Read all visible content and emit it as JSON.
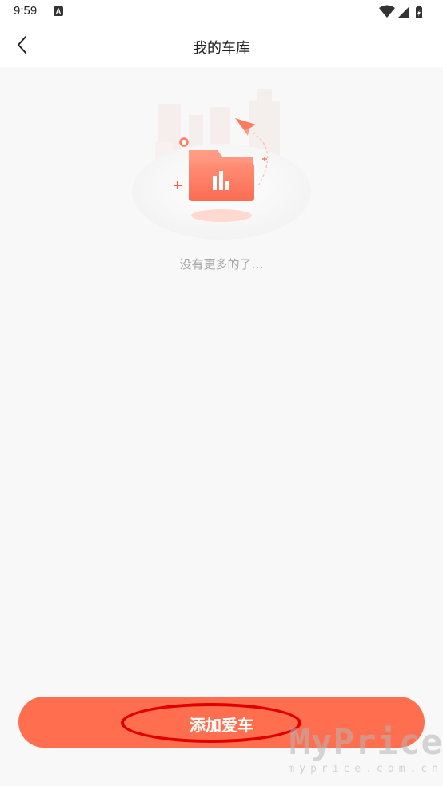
{
  "status_bar": {
    "time": "9:59",
    "notification_glyph": "A",
    "icons": [
      "wifi-icon",
      "signal-icon",
      "battery-icon"
    ]
  },
  "header": {
    "title": "我的车库",
    "back_icon": "chevron-left-icon"
  },
  "empty_state": {
    "message": "没有更多的了…",
    "illustration": "empty-folder-illustration"
  },
  "footer": {
    "add_button_label": "添加爱车"
  },
  "watermark": {
    "brand": "MyPrice",
    "url": "myprice.com.cn"
  },
  "colors": {
    "accent": "#ff6f4f",
    "background": "#f8f8f8",
    "highlight": "#e00000"
  }
}
